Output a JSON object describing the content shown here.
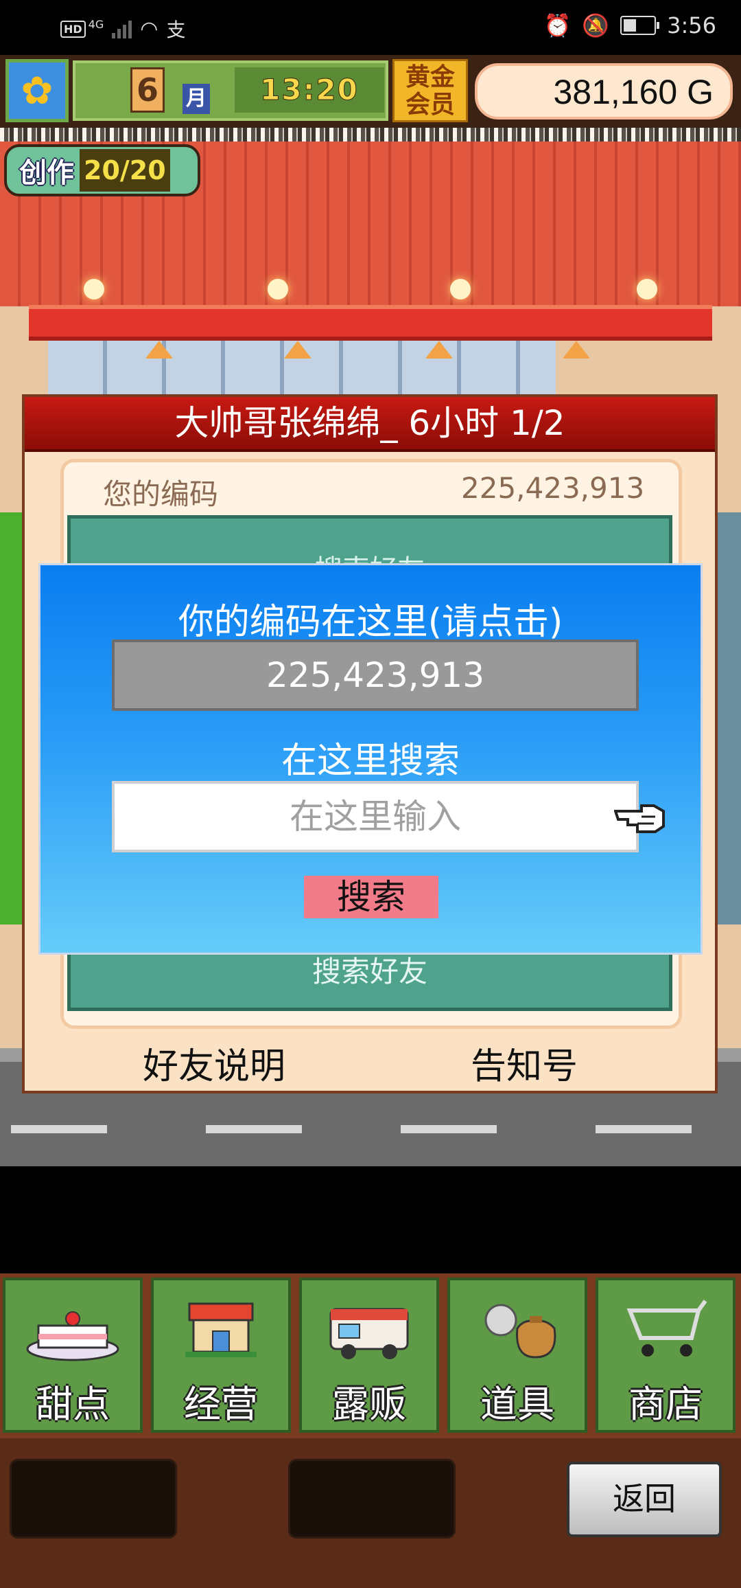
{
  "status_bar": {
    "hd": "HD",
    "network": "4G",
    "pay_icon": "支",
    "time": "3:56",
    "icons": [
      "alarm-icon",
      "mute-icon",
      "battery-icon"
    ]
  },
  "hud": {
    "month": "6",
    "month_unit": "月",
    "clock": "13:20",
    "membership_line1": "黄金",
    "membership_line2": "会员",
    "money": "381,160 G"
  },
  "create_counter": {
    "label": "创作",
    "value": "20/20"
  },
  "friend_panel": {
    "title": "大帅哥张绵绵_  6小时 1/2",
    "your_code_label": "您的编码",
    "your_code_value": "225,423,913",
    "partial_search_text": "搜索好友",
    "search_friend_label": "搜索好友",
    "friend_help_button": "好友说明",
    "notice_button": "告知号"
  },
  "search_dialog": {
    "title": "你的编码在这里(请点击)",
    "code": "225,423,913",
    "search_here": "在这里搜索",
    "input_placeholder": "在这里输入",
    "search_button": "搜索"
  },
  "menu": {
    "items": [
      {
        "label": "甜点",
        "icon": "cake-icon"
      },
      {
        "label": "经营",
        "icon": "shop-icon"
      },
      {
        "label": "露贩",
        "icon": "food-truck-icon"
      },
      {
        "label": "道具",
        "icon": "items-bag-icon"
      },
      {
        "label": "商店",
        "icon": "cart-icon"
      }
    ],
    "back_button": "返回"
  },
  "colors": {
    "dialog_top": "#0a7ef0",
    "dialog_bottom": "#66ccf9",
    "panel_title": "#c71a12",
    "menu_green": "#5f9b47",
    "search_button": "#f27b8a"
  }
}
